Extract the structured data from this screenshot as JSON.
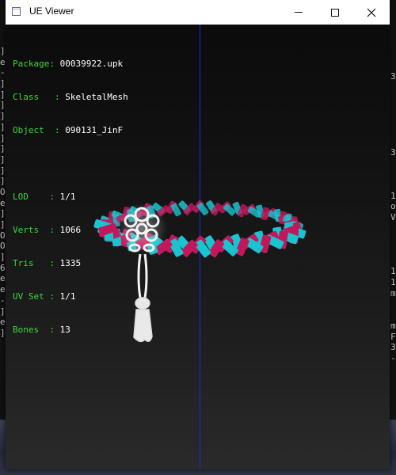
{
  "window": {
    "title": "UE Viewer",
    "controls": [
      "minimize",
      "maximize",
      "close"
    ]
  },
  "info": {
    "package": {
      "label": "Package",
      "value": "00039922.upk"
    },
    "class": {
      "label": "Class",
      "value": "SkeletalMesh"
    },
    "object": {
      "label": "Object",
      "value": "090131_JinF"
    },
    "lod": {
      "label": "LOD",
      "value": "1/1"
    },
    "verts": {
      "label": "Verts",
      "value": "1066"
    },
    "tris": {
      "label": "Tris",
      "value": "1335"
    },
    "uvset": {
      "label": "UV Set",
      "value": "1/1"
    },
    "bones": {
      "label": "Bones",
      "value": "13"
    }
  },
  "background_console": {
    "left_lines": [
      "]",
      "e",
      "-",
      "]",
      "]",
      "]",
      "]",
      "]",
      "]",
      "]",
      "]",
      "]",
      "]",
      "O",
      "e",
      "]",
      "]",
      "O",
      "O",
      "]",
      "6",
      "e",
      "e",
      "-",
      "]",
      "e",
      "]"
    ],
    "right_lines": [
      "3",
      "",
      "",
      "",
      "",
      "",
      "",
      "3",
      "",
      "",
      "",
      "1",
      "o",
      "V",
      "",
      "",
      "",
      "",
      "1",
      "1",
      "m",
      "",
      "",
      "m",
      "F",
      "3",
      "-"
    ]
  },
  "colors": {
    "label_green": "#39d839",
    "value_white": "#ffffff",
    "axis_blue": "#2626d8",
    "braid_pink": "#c2185b",
    "braid_cyan": "#19c3cf",
    "knot_white": "#f2f2f2"
  },
  "model": {
    "description_icon": "braided-bracelet-with-tassel"
  }
}
